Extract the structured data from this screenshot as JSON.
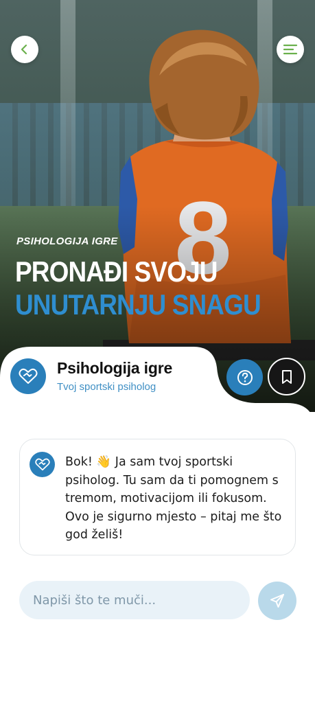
{
  "hero": {
    "eyebrow": "PSIHOLOGIJA IGRE",
    "title_line1": "PRONAĐI SVOJU",
    "title_line2": "UNUTARNJU SNAGU",
    "jersey_number": "8",
    "back_icon": "chevron-left-icon",
    "menu_icon": "menu-icon"
  },
  "header": {
    "title": "Psihologija igre",
    "subtitle": "Tvoj sportski psiholog",
    "logo_icon": "heart-handshake-icon",
    "help_icon": "question-circle-icon",
    "bookmark_icon": "bookmark-icon"
  },
  "chat": {
    "messages": [
      {
        "text": "Bok! 👋 Ja sam tvoj sportski psiholog. Tu sam da ti pomognem s tremom, motivacijom ili fokusom. Ovo je sigurno mjesto – pitaj me što god želiš!",
        "avatar_icon": "heart-handshake-icon"
      }
    ]
  },
  "composer": {
    "placeholder": "Napiši što te muči...",
    "value": "",
    "send_icon": "send-icon"
  },
  "colors": {
    "brand_blue": "#2a7fba",
    "title_accent": "#2f8ed0",
    "send_disabled": "#b9d9ea",
    "input_bg": "#e9f2f8",
    "menu_green": "#6ab04c"
  }
}
